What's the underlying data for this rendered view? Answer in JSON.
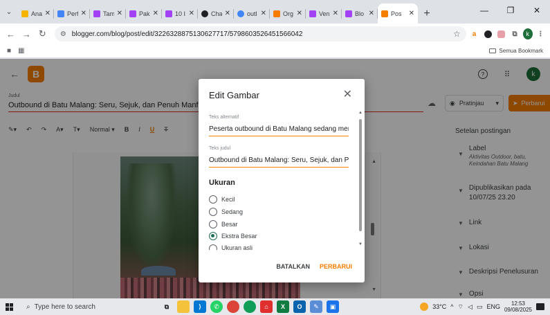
{
  "browser": {
    "tabs": [
      {
        "title": "Anal",
        "color": "#f4b400"
      },
      {
        "title": "Perf",
        "color": "#4285f4"
      },
      {
        "title": "Tam",
        "color": "#a142f4"
      },
      {
        "title": "Pak",
        "color": "#a142f4"
      },
      {
        "title": "10 I",
        "color": "#a142f4"
      },
      {
        "title": "Cha",
        "color": "#202124"
      },
      {
        "title": "outl",
        "color": "#4285f4"
      },
      {
        "title": "Org",
        "color": "#f57d00"
      },
      {
        "title": "Ven",
        "color": "#a142f4"
      },
      {
        "title": "Blo",
        "color": "#a142f4"
      },
      {
        "title": "Pos",
        "color": "#f57d00",
        "active": true
      }
    ],
    "url": "blogger.com/blog/post/edit/3226328875130627717/5798603526451566042",
    "bookmarks_folder": "Semua Bookmark",
    "profile_initial": "k"
  },
  "blogger": {
    "title_label": "Judul",
    "post_title": "Outbound di Batu Malang: Seru, Sejuk, dan Penuh Manfaat",
    "preview_label": "Pratinjau",
    "update_label": "Perbarui",
    "avatar_initial": "k",
    "toolbar_format": "Normal",
    "settings": {
      "heading": "Setelan postingan",
      "label_title": "Label",
      "label_value": "Aktivitas Outdoor, batu, Keindahan Batu Malang",
      "published_title": "Dipublikasikan pada 10/07/25 23.20",
      "link": "Link",
      "location": "Lokasi",
      "search_desc": "Deskripsi Penelusuran",
      "options": "Opsi"
    }
  },
  "modal": {
    "title": "Edit Gambar",
    "alt_label": "Teks alternatif",
    "alt_value": "Peserta outbound di Batu Malang sedang mengikuti",
    "title_label": "Teks judul",
    "title_value": "Outbound di Batu Malang: Seru, Sejuk, dan Penuh Manfaat",
    "size_heading": "Ukuran",
    "sizes": [
      {
        "label": "Kecil",
        "checked": false
      },
      {
        "label": "Sedang",
        "checked": false
      },
      {
        "label": "Besar",
        "checked": false
      },
      {
        "label": "Ekstra Besar",
        "checked": true
      },
      {
        "label": "Ukuran asli",
        "checked": false
      }
    ],
    "cancel": "BATALKAN",
    "update": "PERBARUI"
  },
  "taskbar": {
    "search_placeholder": "Type here to search",
    "temperature": "33°C",
    "language": "ENG",
    "time": "12:53",
    "date": "09/08/2025"
  }
}
